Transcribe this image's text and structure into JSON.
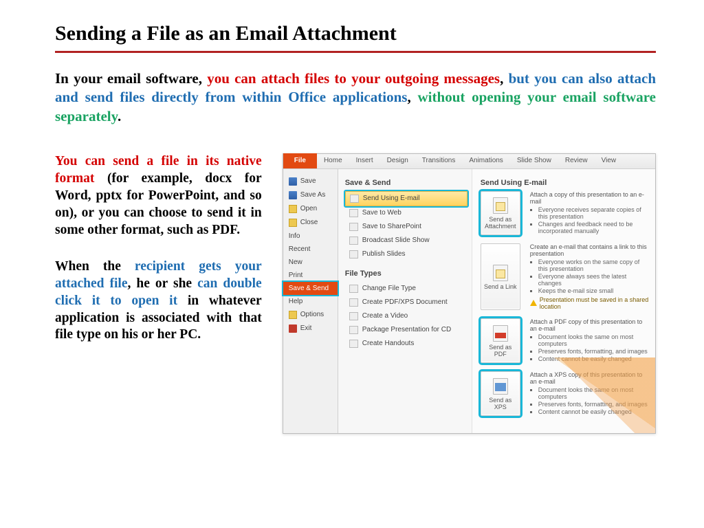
{
  "title": "Sending a File as an Email Attachment",
  "intro": {
    "p1": "In your email software, ",
    "p2": "you can attach files to your outgoing messages",
    "p3": ", ",
    "p4": "but you can also attach and send files directly from within Office applications",
    "p5": ", ",
    "p6": "without opening your email software separately",
    "p7": "."
  },
  "left": {
    "a1": "You can send a file in its native format",
    "a2": " (for example, docx for Word, pptx for PowerPoint, and so on), or you can choose to send it in some other format, such as PDF.",
    "b1": "When the ",
    "b2": "recipient gets your attached file",
    "b3": ", he or she ",
    "b4": "can double click it to open it",
    "b5": " in whatever application is associated with that file type on his or her PC."
  },
  "shot": {
    "tabs": [
      "File",
      "Home",
      "Insert",
      "Design",
      "Transitions",
      "Animations",
      "Slide Show",
      "Review",
      "View"
    ],
    "backstage": {
      "items": [
        {
          "label": "Save",
          "icon": "ico-save"
        },
        {
          "label": "Save As",
          "icon": "ico-saveas"
        },
        {
          "label": "Open",
          "icon": "ico-open"
        },
        {
          "label": "Close",
          "icon": "ico-close"
        },
        {
          "label": "Info"
        },
        {
          "label": "Recent"
        },
        {
          "label": "New"
        },
        {
          "label": "Print"
        },
        {
          "label": "Save & Send",
          "selected": true
        },
        {
          "label": "Help"
        },
        {
          "label": "Options",
          "icon": "ico-opt"
        },
        {
          "label": "Exit",
          "icon": "ico-exit"
        }
      ]
    },
    "mid": {
      "h1": "Save & Send",
      "send_items": [
        {
          "label": "Send Using E-mail",
          "selected": true
        },
        {
          "label": "Save to Web"
        },
        {
          "label": "Save to SharePoint"
        },
        {
          "label": "Broadcast Slide Show"
        },
        {
          "label": "Publish Slides"
        }
      ],
      "h2": "File Types",
      "ft_items": [
        {
          "label": "Change File Type"
        },
        {
          "label": "Create PDF/XPS Document"
        },
        {
          "label": "Create a Video"
        },
        {
          "label": "Package Presentation for CD"
        },
        {
          "label": "Create Handouts"
        }
      ]
    },
    "right": {
      "heading": "Send Using E-mail",
      "options": [
        {
          "btn": "Send as Attachment",
          "glyph": "mail",
          "hl": true,
          "lead": "Attach a copy of this presentation to an e-mail",
          "bullets": [
            "Everyone receives separate copies of this presentation",
            "Changes and feedback need to be incorporated manually"
          ]
        },
        {
          "btn": "Send a Link",
          "glyph": "mail",
          "lead": "Create an e-mail that contains a link to this presentation",
          "bullets": [
            "Everyone works on the same copy of this presentation",
            "Everyone always sees the latest changes",
            "Keeps the e-mail size small"
          ],
          "warn": "Presentation must be saved in a shared location"
        },
        {
          "btn": "Send as PDF",
          "glyph": "pdf",
          "hl": true,
          "lead": "Attach a PDF copy of this presentation to an e-mail",
          "bullets": [
            "Document looks the same on most computers",
            "Preserves fonts, formatting, and images",
            "Content cannot be easily changed"
          ]
        },
        {
          "btn": "Send as XPS",
          "glyph": "xps",
          "hl": true,
          "lead": "Attach a XPS copy of this presentation to an e-mail",
          "bullets": [
            "Document looks the same on most computers",
            "Preserves fonts, formatting, and images",
            "Content cannot be easily changed"
          ]
        }
      ]
    }
  }
}
